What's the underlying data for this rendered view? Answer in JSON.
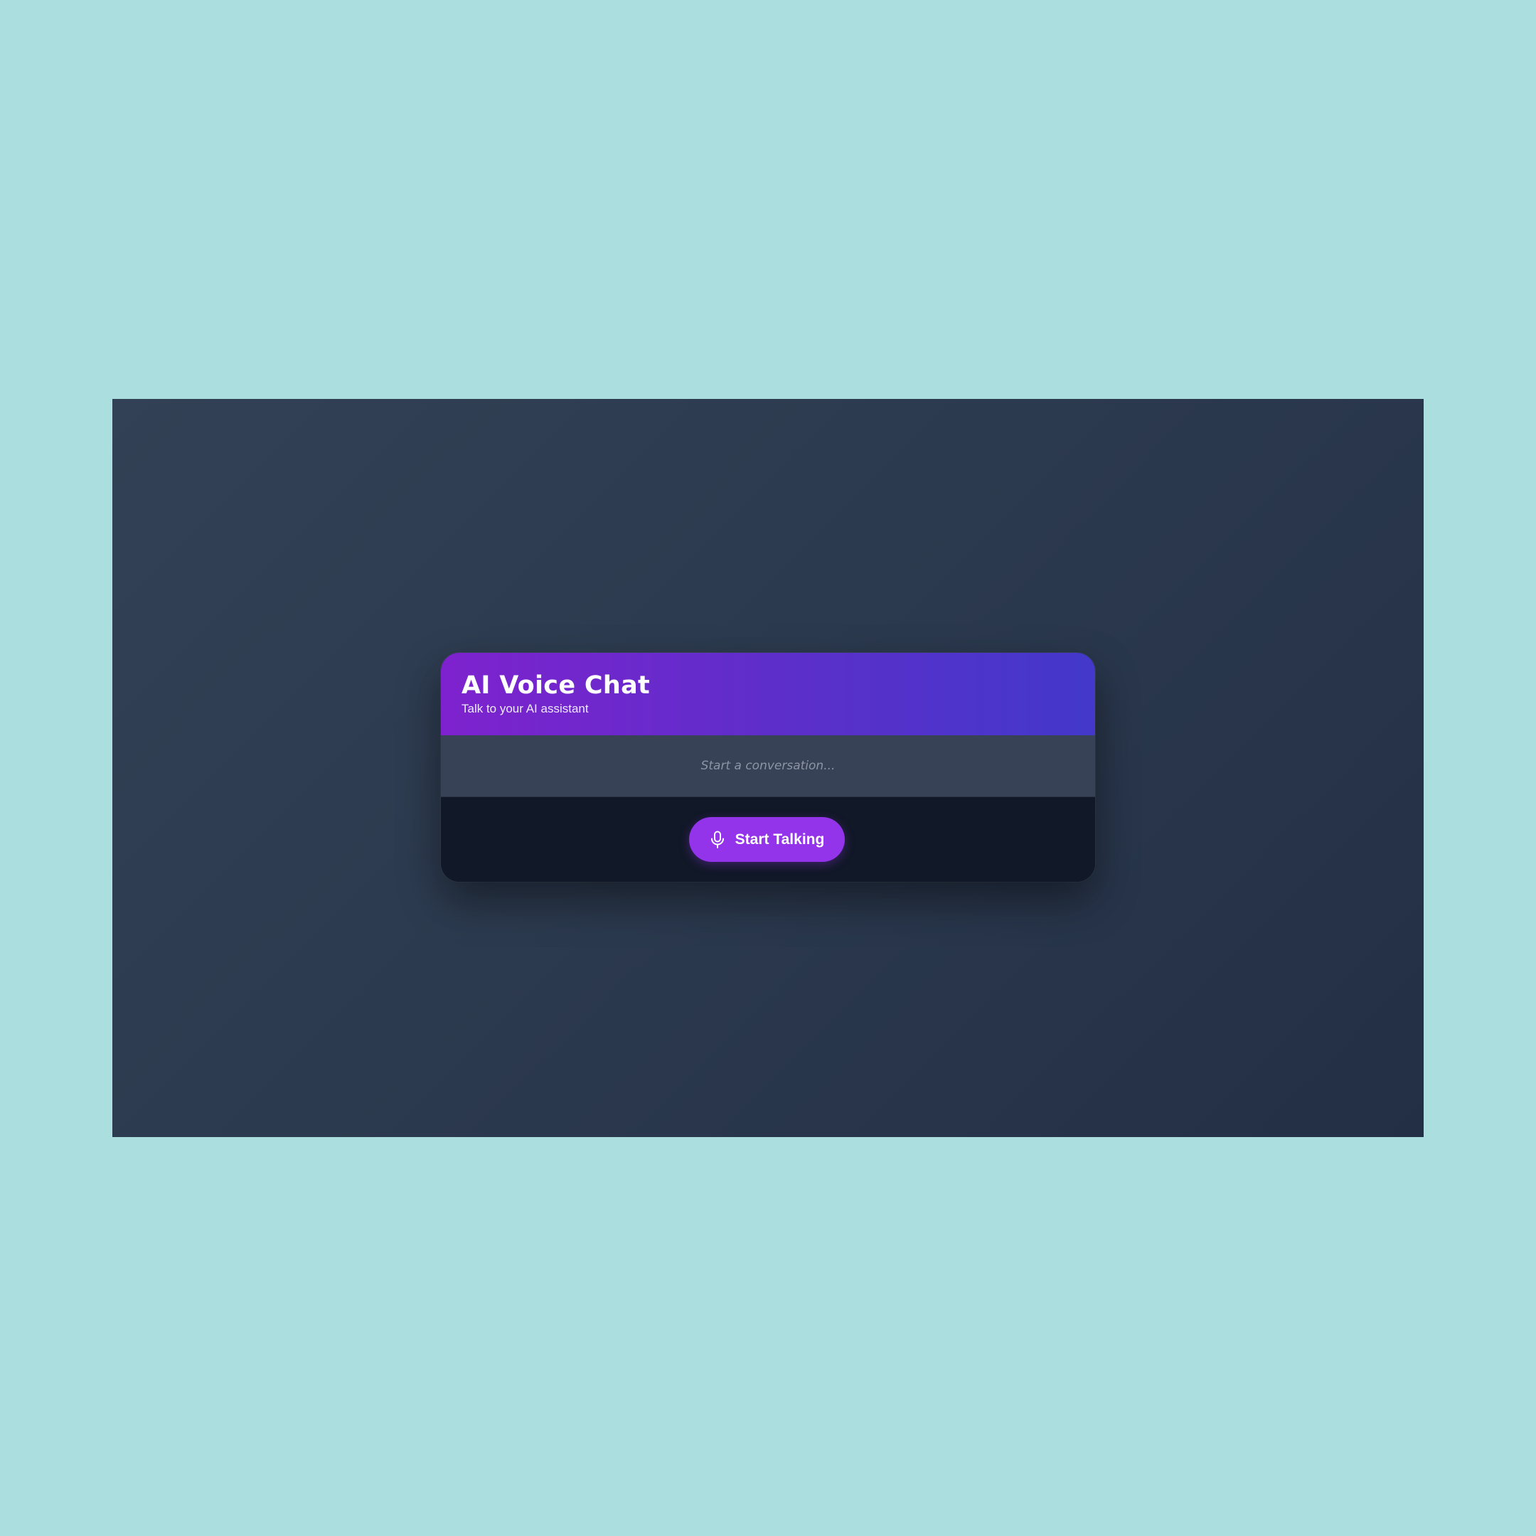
{
  "header": {
    "title": "AI Voice Chat",
    "subtitle": "Talk to your AI assistant"
  },
  "conversation": {
    "placeholder": "Start a conversation..."
  },
  "controls": {
    "start_label": "Start Talking",
    "start_icon": "microphone-icon"
  },
  "colors": {
    "page_background": "#abdedf",
    "app_background": "#2c3a4f",
    "header_gradient_start": "#7e22ce",
    "header_gradient_end": "#4338ca",
    "conversation_background": "#374256",
    "controls_background": "#111827",
    "button_accent": "#9333ea"
  }
}
